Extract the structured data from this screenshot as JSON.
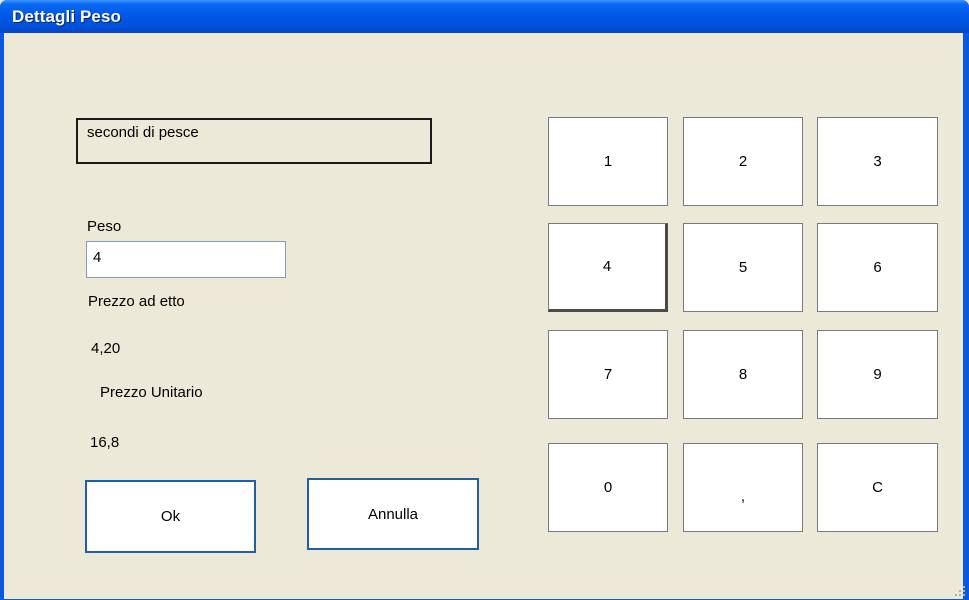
{
  "window": {
    "title": "Dettagli Peso"
  },
  "product": {
    "description": "secondi di pesce"
  },
  "peso": {
    "label": "Peso",
    "value": "4"
  },
  "prezzo_etto": {
    "label": "Prezzo ad etto",
    "value": "4,20"
  },
  "prezzo_unitario": {
    "label": "Prezzo Unitario",
    "value": "16,8"
  },
  "actions": {
    "ok": "Ok",
    "cancel": "Annulla"
  },
  "keypad": {
    "k1": "1",
    "k2": "2",
    "k3": "3",
    "k4": "4",
    "k5": "5",
    "k6": "6",
    "k7": "7",
    "k8": "8",
    "k9": "9",
    "k0": "0",
    "kcomma": ",",
    "kclear": "C"
  }
}
